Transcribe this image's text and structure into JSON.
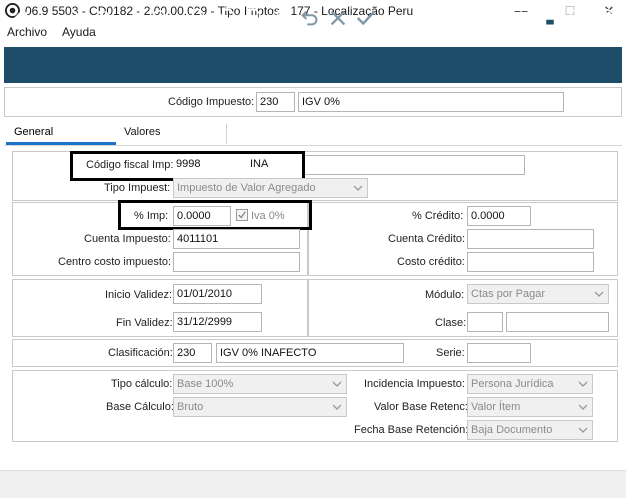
{
  "window": {
    "title": "06.9.5503 - CD0182 - 2.00.00.029 - Tipo Imptos - 177 - Localização Peru",
    "minimize": "—",
    "maximize": "☐",
    "close": "✕"
  },
  "menu": {
    "items": [
      "Archivo",
      "Ayuda"
    ]
  },
  "toolbar": {
    "left_icons": [
      "first-icon",
      "prev-icon",
      "next-icon",
      "last-icon",
      "return-icon",
      "search-icon",
      "new-icon",
      "copy-icon",
      "edit-icon",
      "delete-icon",
      "undo-icon",
      "cancel-icon",
      "confirm-icon"
    ],
    "right_icons": [
      "tree-icon",
      "print-icon",
      "exit-icon",
      "help-icon"
    ],
    "color": "#1f4e6b"
  },
  "header": {
    "codigo_label": "Código Impuesto:",
    "codigo_value": "230",
    "codigo_desc": "IGV 0%"
  },
  "tabs": [
    {
      "label": "General",
      "active": true
    },
    {
      "label": "Valores",
      "active": false
    }
  ],
  "form": {
    "codigo_fiscal_label": "Código fiscal Imp:",
    "codigo_fiscal_value": "9998",
    "codigo_fiscal_code": "INA",
    "codigo_fiscal_extra": "",
    "tipo_impuest_label": "Tipo Impuest:",
    "tipo_impuest_value": "Impuesto de Valor Agregado",
    "pct_imp_label": "% Imp:",
    "pct_imp_value": "0.0000",
    "iva_label": "Iva 0%",
    "iva_checked": true,
    "cuenta_impuesto_label": "Cuenta Impuesto:",
    "cuenta_impuesto_value": "4011101",
    "centro_costo_label": "Centro costo impuesto:",
    "centro_costo_value": "",
    "pct_credito_label": "% Crédito:",
    "pct_credito_value": "0.0000",
    "cuenta_credito_label": "Cuenta Crédito:",
    "cuenta_credito_value": "",
    "costo_credito_label": "Costo crédito:",
    "costo_credito_value": "",
    "inicio_validez_label": "Inicio Validez:",
    "inicio_validez_value": "01/01/2010",
    "fin_validez_label": "Fin Validez:",
    "fin_validez_value": "31/12/2999",
    "modulo_label": "Módulo:",
    "modulo_value": "Ctas por Pagar",
    "clase_label": "Clase:",
    "clase_value": "",
    "clase_desc": "",
    "clasificacion_label": "Clasificación:",
    "clasificacion_value": "230",
    "clasificacion_desc": "IGV 0% INAFECTO",
    "serie_label": "Serie:",
    "serie_value": "",
    "tipo_calculo_label": "Tipo cálculo:",
    "tipo_calculo_value": "Base 100%",
    "base_calculo_label": "Base Cálculo:",
    "base_calculo_value": "Bruto",
    "incidencia_label": "Incidencia Impuesto:",
    "incidencia_value": "Persona Jurídica",
    "valor_base_label": "Valor Base Retenc:",
    "valor_base_value": "Valor Ítem",
    "fecha_base_label": "Fecha Base Retención:",
    "fecha_base_value": "Baja Documento"
  }
}
